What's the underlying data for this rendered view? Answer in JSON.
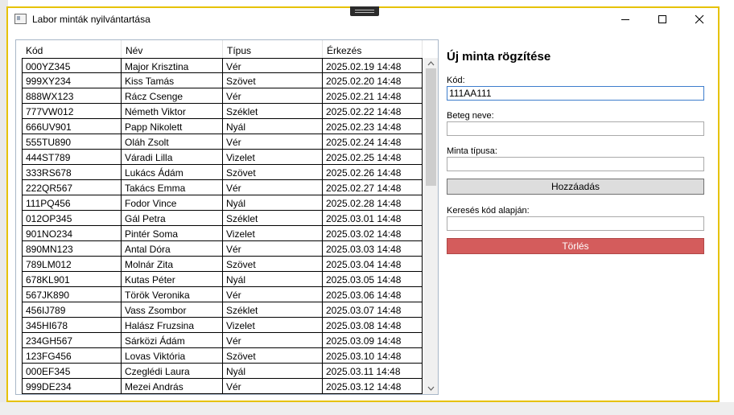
{
  "window": {
    "title": "Labor minták nyilvántartása",
    "icon": "app-window-icon",
    "controls": [
      "minimize-icon",
      "maximize-icon",
      "close-icon"
    ]
  },
  "grid": {
    "columns": [
      "Kód",
      "Név",
      "Típus",
      "Érkezés"
    ],
    "rows": [
      [
        "000YZ345",
        "Major Krisztina",
        "Vér",
        "2025.02.19 14:48"
      ],
      [
        "999XY234",
        "Kiss Tamás",
        "Szövet",
        "2025.02.20 14:48"
      ],
      [
        "888WX123",
        "Rácz Csenge",
        "Vér",
        "2025.02.21 14:48"
      ],
      [
        "777VW012",
        "Németh Viktor",
        "Széklet",
        "2025.02.22 14:48"
      ],
      [
        "666UV901",
        "Papp Nikolett",
        "Nyál",
        "2025.02.23 14:48"
      ],
      [
        "555TU890",
        "Oláh Zsolt",
        "Vér",
        "2025.02.24 14:48"
      ],
      [
        "444ST789",
        "Váradi Lilla",
        "Vizelet",
        "2025.02.25 14:48"
      ],
      [
        "333RS678",
        "Lukács Ádám",
        "Szövet",
        "2025.02.26 14:48"
      ],
      [
        "222QR567",
        "Takács Emma",
        "Vér",
        "2025.02.27 14:48"
      ],
      [
        "111PQ456",
        "Fodor Vince",
        "Nyál",
        "2025.02.28 14:48"
      ],
      [
        "012OP345",
        "Gál Petra",
        "Széklet",
        "2025.03.01 14:48"
      ],
      [
        "901NO234",
        "Pintér Soma",
        "Vizelet",
        "2025.03.02 14:48"
      ],
      [
        "890MN123",
        "Antal Dóra",
        "Vér",
        "2025.03.03 14:48"
      ],
      [
        "789LM012",
        "Molnár Zita",
        "Szövet",
        "2025.03.04 14:48"
      ],
      [
        "678KL901",
        "Kutas Péter",
        "Nyál",
        "2025.03.05 14:48"
      ],
      [
        "567JK890",
        "Török Veronika",
        "Vér",
        "2025.03.06 14:48"
      ],
      [
        "456IJ789",
        "Vass Zsombor",
        "Széklet",
        "2025.03.07 14:48"
      ],
      [
        "345HI678",
        "Halász Fruzsina",
        "Vizelet",
        "2025.03.08 14:48"
      ],
      [
        "234GH567",
        "Sárközi Ádám",
        "Vér",
        "2025.03.09 14:48"
      ],
      [
        "123FG456",
        "Lovas Viktória",
        "Szövet",
        "2025.03.10 14:48"
      ],
      [
        "000EF345",
        "Czeglédi Laura",
        "Nyál",
        "2025.03.11 14:48"
      ],
      [
        "999DE234",
        "Mezei András",
        "Vér",
        "2025.03.12 14:48"
      ]
    ]
  },
  "form": {
    "heading": "Új minta rögzítése",
    "code_label": "Kód:",
    "code_value": "111AA111",
    "patient_label": "Beteg neve:",
    "patient_value": "",
    "type_label": "Minta típusa:",
    "type_value": "",
    "add_button": "Hozzáadás",
    "search_label": "Keresés kód alapján:",
    "search_value": "",
    "delete_button": "Törlés"
  },
  "colors": {
    "window_border": "#e6c200",
    "delete_button": "#d45c5c",
    "focus_border": "#3e7dcc"
  }
}
